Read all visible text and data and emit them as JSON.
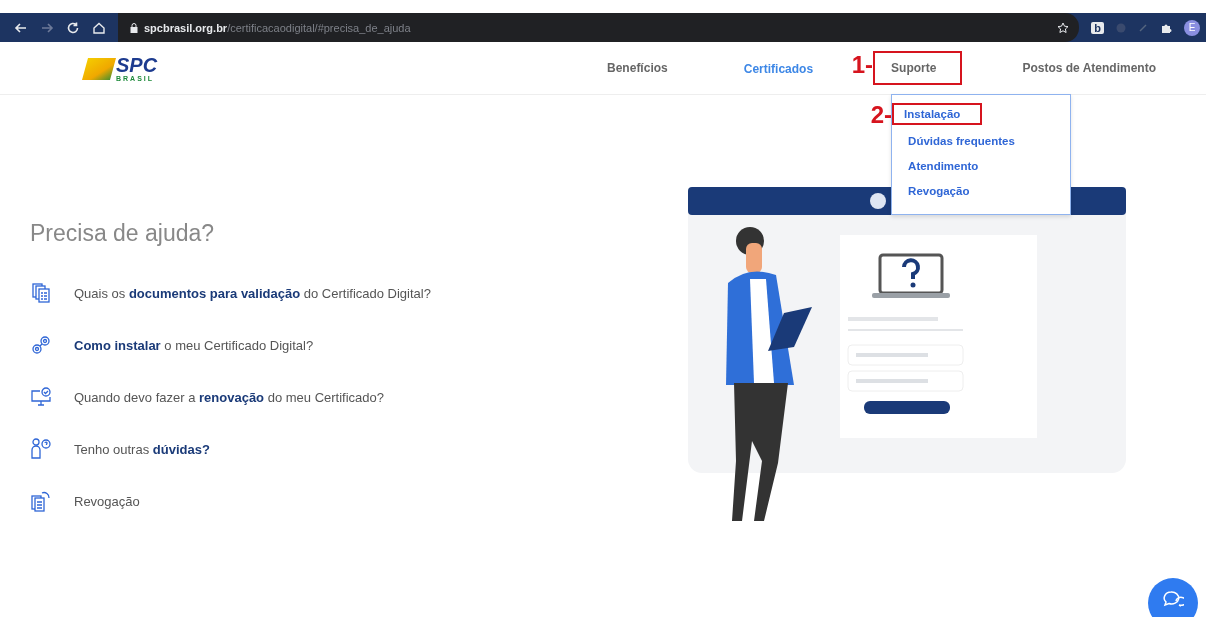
{
  "browser": {
    "url_host": "spcbrasil.org.br",
    "url_path": "/certificacaodigital/#precisa_de_ajuda",
    "extension_label": "b",
    "profile_initial": "E"
  },
  "logo": {
    "name": "SPC",
    "subtitle": "BRASIL"
  },
  "nav": [
    {
      "label": "Benefícios",
      "selected": false
    },
    {
      "label": "Certificados",
      "selected": true
    },
    {
      "label": "Suporte",
      "selected": false,
      "annotation": "1-"
    },
    {
      "label": "Postos de Atendimento",
      "selected": false
    }
  ],
  "dropdown": [
    {
      "label": "Instalação",
      "annotation": "2-"
    },
    {
      "label": "Dúvidas frequentes"
    },
    {
      "label": "Atendimento"
    },
    {
      "label": "Revogação"
    }
  ],
  "help": {
    "title": "Precisa de ajuda?",
    "items": [
      {
        "kind": "documents",
        "text": "Quais os **documentos para validação** do Certificado Digital?"
      },
      {
        "kind": "gears",
        "text": "**Como instalar** o meu Certificado Digital?"
      },
      {
        "kind": "monitor",
        "text": "Quando devo fazer a **renovação** do meu Certificado?"
      },
      {
        "kind": "person",
        "text": "Tenho outras **dúvidas?**"
      },
      {
        "kind": "revoke",
        "text": "Revogação"
      }
    ]
  }
}
